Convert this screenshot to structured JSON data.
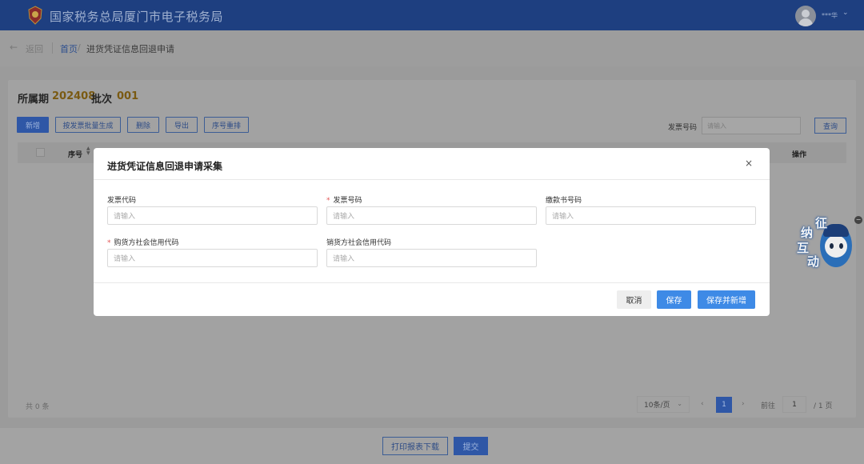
{
  "header": {
    "title": "国家税务总局厦门市电子税务局",
    "user_name": "***华"
  },
  "breadcrumb": {
    "back_label": "返回",
    "home": "首页",
    "separator": "/",
    "current": "进货凭证信息回退申请"
  },
  "page": {
    "period_label": "所属期",
    "period_value": "202408",
    "batch_label": "批次",
    "batch_value": "001"
  },
  "toolbar": {
    "add": "新增",
    "batch_generate": "按发票批量生成",
    "delete": "删除",
    "export": "导出",
    "reorder": "序号重排",
    "invoice_no_label": "发票号码",
    "invoice_no_placeholder": "请输入",
    "query": "查询"
  },
  "table": {
    "col_seq": "序号",
    "col_op": "操作"
  },
  "pagination": {
    "total": "共 0 条",
    "page_size": "10条/页",
    "current_page": "1",
    "goto_label": "前往",
    "goto_value": "1",
    "total_pages": "/ 1 页"
  },
  "footer": {
    "print": "打印报表下载",
    "submit": "提交"
  },
  "widget": {
    "chars": [
      "征",
      "纳",
      "互",
      "动"
    ]
  },
  "modal": {
    "title": "进货凭证信息回退申请采集",
    "close": "×",
    "fields": [
      {
        "label": "发票代码",
        "required": false,
        "placeholder": "请输入"
      },
      {
        "label": "发票号码",
        "required": true,
        "placeholder": "请输入"
      },
      {
        "label": "缴款书号码",
        "required": false,
        "placeholder": "请输入"
      },
      {
        "label": "购货方社会信用代码",
        "required": true,
        "placeholder": "请输入"
      },
      {
        "label": "销货方社会信用代码",
        "required": false,
        "placeholder": "请输入"
      }
    ],
    "required_mark": "*",
    "cancel": "取消",
    "save": "保存",
    "save_and_new": "保存并新增"
  }
}
